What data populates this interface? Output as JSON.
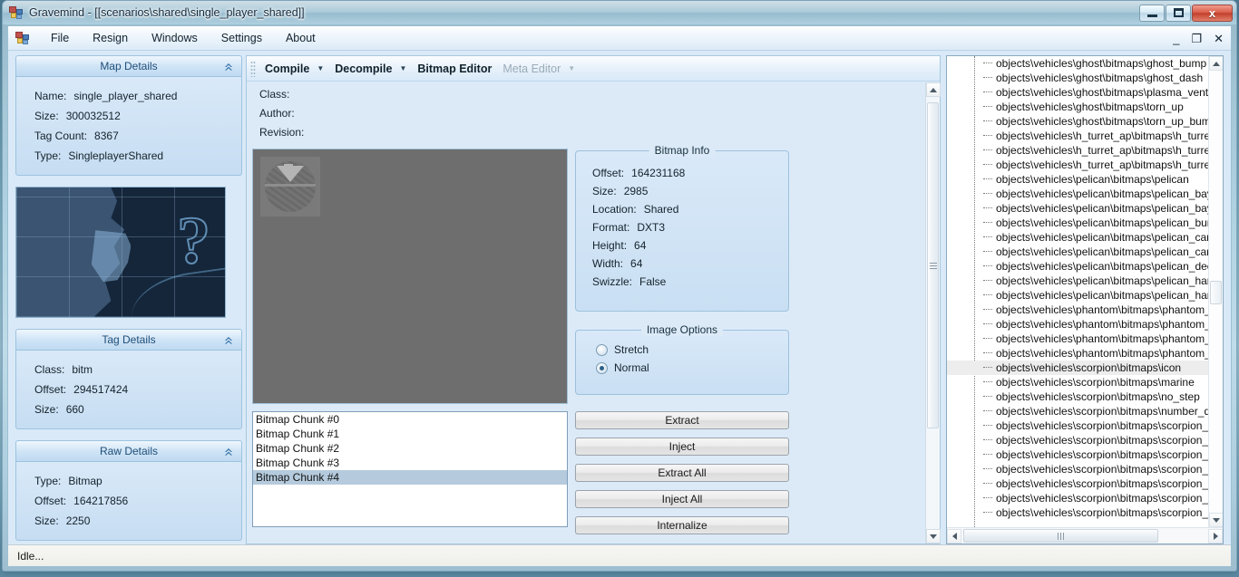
{
  "window": {
    "title": "Gravemind - [[scenarios\\shared\\single_player_shared]]",
    "minimize_label": "Minimize",
    "maximize_label": "Maximize",
    "close_label": "x"
  },
  "menubar": {
    "items": [
      {
        "label": "File"
      },
      {
        "label": "Resign"
      },
      {
        "label": "Windows"
      },
      {
        "label": "Settings"
      },
      {
        "label": "About"
      }
    ],
    "child_minimize": "_",
    "child_restore": "❐",
    "child_close": "✕"
  },
  "map_details": {
    "title": "Map Details",
    "rows": [
      {
        "key": "Name:",
        "value": "single_player_shared"
      },
      {
        "key": "Size:",
        "value": "300032512"
      },
      {
        "key": "Tag Count:",
        "value": "8367"
      },
      {
        "key": "Type:",
        "value": "SingleplayerShared"
      }
    ]
  },
  "tag_details": {
    "title": "Tag Details",
    "rows": [
      {
        "key": "Class:",
        "value": "bitm"
      },
      {
        "key": "Offset:",
        "value": "294517424"
      },
      {
        "key": "Size:",
        "value": "660"
      }
    ]
  },
  "raw_details": {
    "title": "Raw Details",
    "rows": [
      {
        "key": "Type:",
        "value": "Bitmap"
      },
      {
        "key": "Offset:",
        "value": "164217856"
      },
      {
        "key": "Size:",
        "value": "2250"
      }
    ]
  },
  "toolstrip": {
    "compile": "Compile",
    "decompile": "Decompile",
    "bitmap_editor": "Bitmap Editor",
    "meta_editor": "Meta Editor"
  },
  "meta": {
    "class_label": "Class:",
    "author_label": "Author:",
    "revision_label": "Revision:",
    "class_value": "",
    "author_value": "",
    "revision_value": ""
  },
  "bitmap_info": {
    "legend": "Bitmap Info",
    "rows": [
      {
        "key": "Offset:",
        "value": "164231168"
      },
      {
        "key": "Size:",
        "value": "2985"
      },
      {
        "key": "Location:",
        "value": "Shared"
      },
      {
        "key": "Format:",
        "value": "DXT3"
      },
      {
        "key": "Height:",
        "value": "64"
      },
      {
        "key": "Width:",
        "value": "64"
      },
      {
        "key": "Swizzle:",
        "value": "False"
      }
    ]
  },
  "image_options": {
    "legend": "Image Options",
    "options": [
      {
        "label": "Stretch",
        "selected": false
      },
      {
        "label": "Normal",
        "selected": true
      }
    ]
  },
  "actions": [
    {
      "label": "Extract"
    },
    {
      "label": "Inject"
    },
    {
      "label": "Extract All"
    },
    {
      "label": "Inject All"
    },
    {
      "label": "Internalize"
    }
  ],
  "chunks": {
    "items": [
      {
        "label": "Bitmap Chunk #0",
        "selected": false
      },
      {
        "label": "Bitmap Chunk #1",
        "selected": false
      },
      {
        "label": "Bitmap Chunk #2",
        "selected": false
      },
      {
        "label": "Bitmap Chunk #3",
        "selected": false
      },
      {
        "label": "Bitmap Chunk #4",
        "selected": true
      }
    ]
  },
  "tag_tree": {
    "nodes": [
      {
        "label": "objects\\vehicles\\ghost\\bitmaps\\ghost_bump",
        "selected": false
      },
      {
        "label": "objects\\vehicles\\ghost\\bitmaps\\ghost_dash",
        "selected": false
      },
      {
        "label": "objects\\vehicles\\ghost\\bitmaps\\plasma_vent",
        "selected": false
      },
      {
        "label": "objects\\vehicles\\ghost\\bitmaps\\torn_up",
        "selected": false
      },
      {
        "label": "objects\\vehicles\\ghost\\bitmaps\\torn_up_bump",
        "selected": false
      },
      {
        "label": "objects\\vehicles\\h_turret_ap\\bitmaps\\h_turret_a",
        "selected": false
      },
      {
        "label": "objects\\vehicles\\h_turret_ap\\bitmaps\\h_turret_a",
        "selected": false
      },
      {
        "label": "objects\\vehicles\\h_turret_ap\\bitmaps\\h_turret_c",
        "selected": false
      },
      {
        "label": "objects\\vehicles\\pelican\\bitmaps\\pelican",
        "selected": false
      },
      {
        "label": "objects\\vehicles\\pelican\\bitmaps\\pelican_bay",
        "selected": false
      },
      {
        "label": "objects\\vehicles\\pelican\\bitmaps\\pelican_bay_l",
        "selected": false
      },
      {
        "label": "objects\\vehicles\\pelican\\bitmaps\\pelican_bump",
        "selected": false
      },
      {
        "label": "objects\\vehicles\\pelican\\bitmaps\\pelican_cargo",
        "selected": false
      },
      {
        "label": "objects\\vehicles\\pelican\\bitmaps\\pelican_cargo",
        "selected": false
      },
      {
        "label": "objects\\vehicles\\pelican\\bitmaps\\pelican_deca",
        "selected": false
      },
      {
        "label": "objects\\vehicles\\pelican\\bitmaps\\pelican_hard_",
        "selected": false
      },
      {
        "label": "objects\\vehicles\\pelican\\bitmaps\\pelican_hard_",
        "selected": false
      },
      {
        "label": "objects\\vehicles\\phantom\\bitmaps\\phantom_ar",
        "selected": false
      },
      {
        "label": "objects\\vehicles\\phantom\\bitmaps\\phantom_de",
        "selected": false
      },
      {
        "label": "objects\\vehicles\\phantom\\bitmaps\\phantom_ex",
        "selected": false
      },
      {
        "label": "objects\\vehicles\\phantom\\bitmaps\\phantom_ex",
        "selected": false
      },
      {
        "label": "objects\\vehicles\\scorpion\\bitmaps\\icon",
        "selected": true
      },
      {
        "label": "objects\\vehicles\\scorpion\\bitmaps\\marine",
        "selected": false
      },
      {
        "label": "objects\\vehicles\\scorpion\\bitmaps\\no_step",
        "selected": false
      },
      {
        "label": "objects\\vehicles\\scorpion\\bitmaps\\number_dec",
        "selected": false
      },
      {
        "label": "objects\\vehicles\\scorpion\\bitmaps\\scorpion_de",
        "selected": false
      },
      {
        "label": "objects\\vehicles\\scorpion\\bitmaps\\scorpion_gu",
        "selected": false
      },
      {
        "label": "objects\\vehicles\\scorpion\\bitmaps\\scorpion_gu",
        "selected": false
      },
      {
        "label": "objects\\vehicles\\scorpion\\bitmaps\\scorpion_hu",
        "selected": false
      },
      {
        "label": "objects\\vehicles\\scorpion\\bitmaps\\scorpion_hu",
        "selected": false
      },
      {
        "label": "objects\\vehicles\\scorpion\\bitmaps\\scorpion_tre",
        "selected": false
      },
      {
        "label": "objects\\vehicles\\scorpion\\bitmaps\\scorpion_tre",
        "selected": false
      }
    ]
  },
  "statusbar": {
    "text": "Idle..."
  },
  "colors": {
    "accent": "#1f4e79",
    "panel_bg": "#d9e9f7",
    "selection": "#b5cbdd",
    "close_button": "#c1402c"
  }
}
